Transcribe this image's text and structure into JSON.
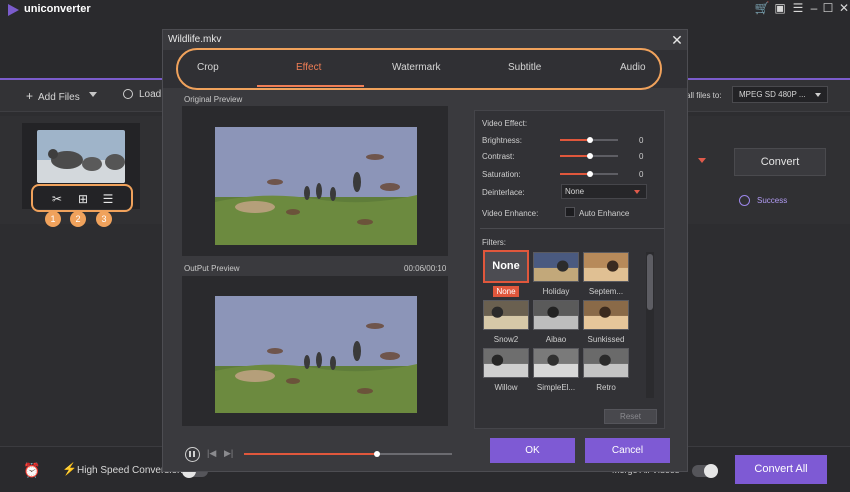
{
  "app": {
    "name": "uniconverter",
    "accent": "#7e5ad4",
    "window_controls": [
      "cart-icon",
      "gift-icon",
      "menu-icon",
      "minimize-icon",
      "maximize-icon",
      "close-icon"
    ]
  },
  "toolbar": {
    "add_files": "Add Files",
    "load": "Load",
    "convert_all_to": "all files to:",
    "format": "MPEG SD 480P ..."
  },
  "file_row": {
    "convert": "Convert",
    "success": "Success",
    "tools": [
      "trim-icon",
      "crop-icon",
      "effect-icon"
    ],
    "badges": [
      "1",
      "2",
      "3"
    ]
  },
  "bottom": {
    "high_speed": "High Speed Conversion",
    "merge": "Merge All Videos",
    "convert_all": "Convert All"
  },
  "dialog": {
    "title": "Wildlife.mkv",
    "tabs": [
      "Crop",
      "Effect",
      "Watermark",
      "Subtitle",
      "Audio"
    ],
    "active_tab": "Effect",
    "original_preview": "Original Preview",
    "output_preview": "OutPut Preview",
    "time": "00:06/00:10",
    "playback_progress": 0.64,
    "video_effect": "Video Effect:",
    "brightness": {
      "label": "Brightness:",
      "value": "0"
    },
    "contrast": {
      "label": "Contrast:",
      "value": "0"
    },
    "saturation": {
      "label": "Saturation:",
      "value": "0"
    },
    "deinterlace": {
      "label": "Deinterlace:",
      "value": "None"
    },
    "video_enhance": "Video Enhance:",
    "auto_enhance": "Auto Enhance",
    "filters_label": "Filters:",
    "filters": [
      "None",
      "Holiday",
      "Septem...",
      "Snow2",
      "Aibao",
      "Sunkissed",
      "Willow",
      "SimpleEl...",
      "Retro"
    ],
    "none_tile": "None",
    "reset": "Reset",
    "ok": "OK",
    "cancel": "Cancel"
  }
}
